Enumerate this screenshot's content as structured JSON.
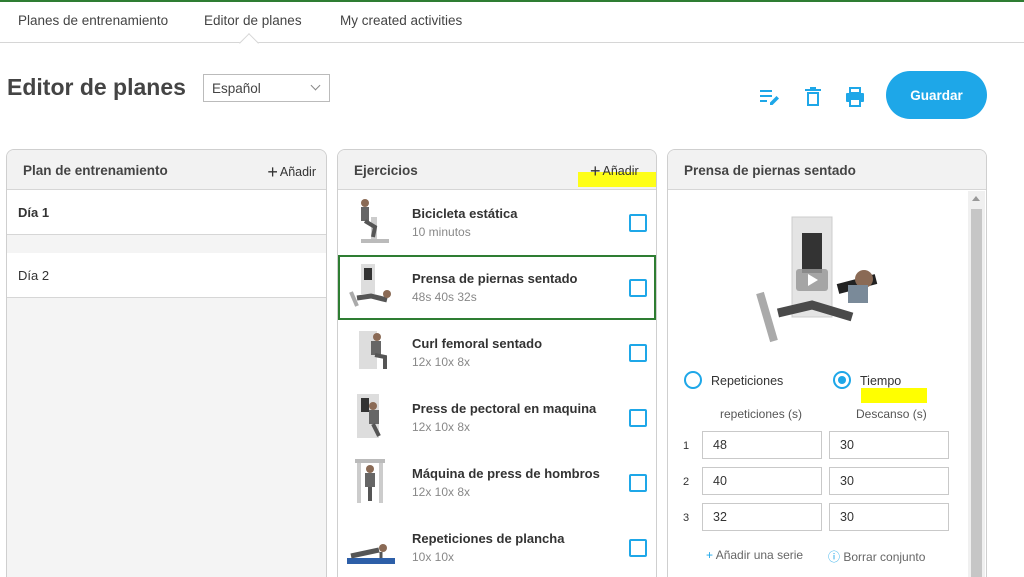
{
  "nav": {
    "tabs": [
      "Planes de entrenamiento",
      "Editor de planes",
      "My created activities"
    ],
    "active_index": 1
  },
  "header": {
    "title": "Editor de planes",
    "language": "Español",
    "save_label": "Guardar"
  },
  "colors": {
    "accent": "#1ea7e8",
    "selected_border": "#2e7d32",
    "highlight": "#ffff00"
  },
  "plan_panel": {
    "title": "Plan de entrenamiento",
    "add_label": "Añadir",
    "days": [
      "Día 1",
      "Día 2"
    ]
  },
  "exercises_panel": {
    "title": "Ejercicios",
    "add_label": "Añadir",
    "items": [
      {
        "name": "Bicicleta estática",
        "detail": "10 minutos"
      },
      {
        "name": "Prensa de piernas sentado",
        "detail": "48s 40s 32s",
        "selected": true
      },
      {
        "name": "Curl femoral sentado",
        "detail": "12x 10x 8x"
      },
      {
        "name": "Press de pectoral en maquina",
        "detail": "12x 10x 8x"
      },
      {
        "name": "Máquina de press de hombros",
        "detail": "12x 10x 8x"
      },
      {
        "name": "Repeticiones de plancha",
        "detail": "10x 10x"
      }
    ]
  },
  "detail_panel": {
    "title": "Prensa de piernas sentado",
    "mode_reps": "Repeticiones",
    "mode_time": "Tiempo",
    "selected_mode": "Tiempo",
    "col_reps": "repeticiones (s)",
    "col_rest": "Descanso (s)",
    "sets": [
      {
        "n": "1",
        "reps": "48",
        "rest": "30"
      },
      {
        "n": "2",
        "reps": "40",
        "rest": "30"
      },
      {
        "n": "3",
        "reps": "32",
        "rest": "30"
      }
    ],
    "add_set": "Añadir una serie",
    "clear_set": "Borrar conjunto"
  }
}
